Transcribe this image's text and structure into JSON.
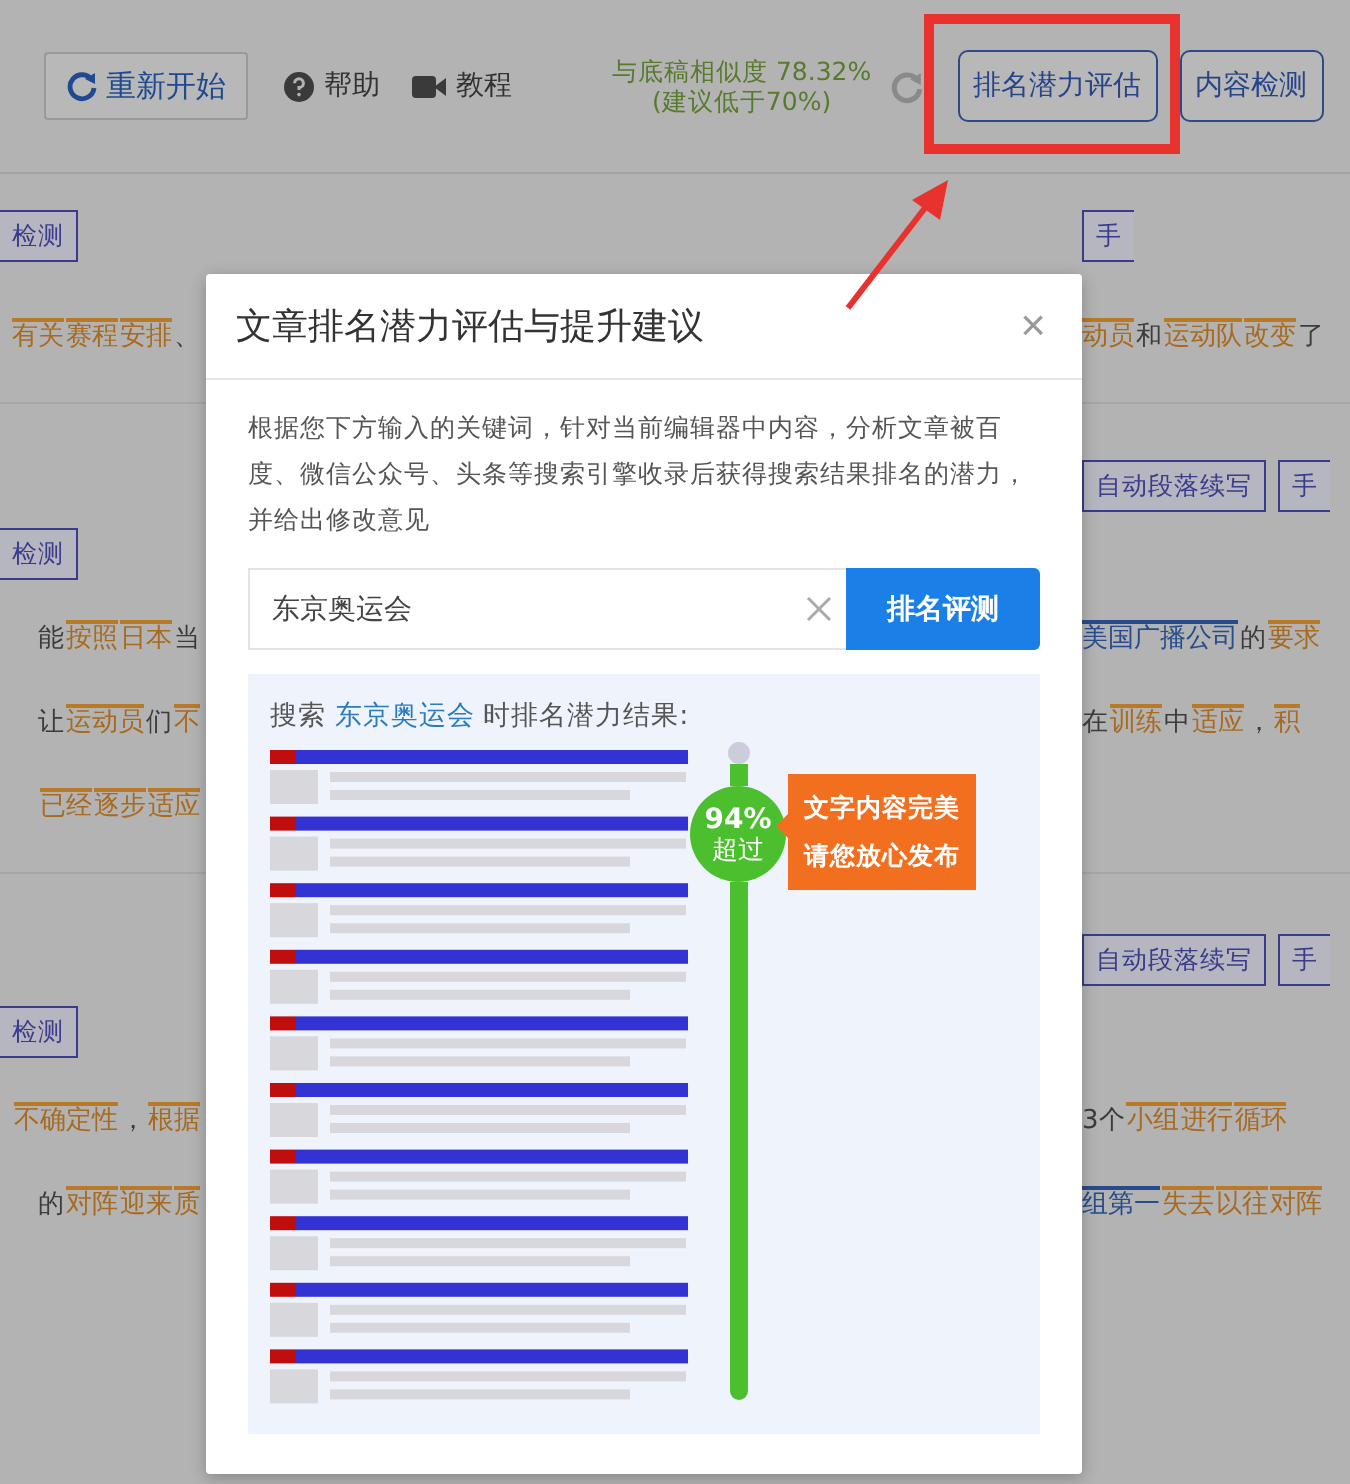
{
  "toolbar": {
    "restart_button": "重新开始",
    "help": "帮助",
    "tutorial": "教程",
    "similarity": "与底稿相似度 78.32%",
    "similarity_hint": "(建议低于70%)",
    "buttons": [
      {
        "label": "排名潜力评估",
        "highlighted": true
      },
      {
        "label": "内容检测",
        "highlighted": false
      }
    ]
  },
  "editor_rows": [
    {
      "kind": "buttons",
      "left": [
        "检测"
      ],
      "right": [
        "手"
      ]
    },
    {
      "kind": "text",
      "left": [
        {
          "text": "有关",
          "kind": "term"
        },
        {
          "text": "赛程",
          "kind": "term"
        },
        {
          "text": "安排",
          "kind": "term"
        },
        {
          "text": "、",
          "kind": "plain"
        }
      ],
      "right": [
        {
          "text": "动员",
          "kind": "term"
        },
        {
          "text": "和",
          "kind": "plain"
        },
        {
          "text": "运动队",
          "kind": "term"
        },
        {
          "text": "改变",
          "kind": "term"
        },
        {
          "text": "了",
          "kind": "plain"
        }
      ]
    },
    {
      "kind": "buttons",
      "left": [],
      "right": [
        "自动段落续写",
        "手"
      ]
    },
    {
      "kind": "buttons",
      "left": [
        "检测"
      ],
      "right": []
    },
    {
      "kind": "text",
      "left": [
        {
          "text": "能",
          "kind": "plain"
        },
        {
          "text": "按照",
          "kind": "term"
        },
        {
          "text": "日本",
          "kind": "term"
        },
        {
          "text": "当",
          "kind": "plain"
        }
      ],
      "right": [
        {
          "text": "美国广播公司",
          "kind": "entity"
        },
        {
          "text": "的",
          "kind": "plain"
        },
        {
          "text": "要求",
          "kind": "term"
        }
      ]
    },
    {
      "kind": "text",
      "left": [
        {
          "text": "让",
          "kind": "plain"
        },
        {
          "text": "运动员",
          "kind": "term"
        },
        {
          "text": "们",
          "kind": "plain"
        },
        {
          "text": "不",
          "kind": "term"
        }
      ],
      "right": [
        {
          "text": "在",
          "kind": "plain"
        },
        {
          "text": "训练",
          "kind": "term"
        },
        {
          "text": "中",
          "kind": "plain"
        },
        {
          "text": "适应",
          "kind": "term"
        },
        {
          "text": "，",
          "kind": "plain"
        },
        {
          "text": "积",
          "kind": "term"
        }
      ]
    },
    {
      "kind": "text",
      "left": [
        {
          "text": "已经",
          "kind": "term"
        },
        {
          "text": "逐步",
          "kind": "term"
        },
        {
          "text": "适应",
          "kind": "term"
        }
      ],
      "right": []
    },
    {
      "kind": "buttons",
      "left": [],
      "right": [
        "自动段落续写",
        "手"
      ]
    },
    {
      "kind": "buttons",
      "left": [
        "检测"
      ],
      "right": []
    },
    {
      "kind": "text",
      "left": [
        {
          "text": "不确定性",
          "kind": "term"
        },
        {
          "text": "，",
          "kind": "plain"
        },
        {
          "text": "根据",
          "kind": "term"
        }
      ],
      "right": [
        {
          "text": "3个",
          "kind": "plain"
        },
        {
          "text": "小组",
          "kind": "term"
        },
        {
          "text": "进行",
          "kind": "term"
        },
        {
          "text": "循环",
          "kind": "term"
        }
      ]
    },
    {
      "kind": "text",
      "left": [
        {
          "text": "的",
          "kind": "plain"
        },
        {
          "text": "对阵",
          "kind": "term"
        },
        {
          "text": "迎来",
          "kind": "term"
        },
        {
          "text": "质",
          "kind": "term"
        }
      ],
      "right": [
        {
          "text": "组第一",
          "kind": "entity"
        },
        {
          "text": "失去",
          "kind": "term"
        },
        {
          "text": "以往",
          "kind": "term"
        },
        {
          "text": "对阵",
          "kind": "term"
        }
      ]
    }
  ],
  "dialog": {
    "title": "文章排名潜力评估与提升建议",
    "close": "×",
    "description": "根据您下方输入的关键词，针对当前编辑器中内容，分析文章被百度、微信公众号、头条等搜索引擎收录后获得搜索结果排名的潜力，并给出修改意见",
    "keyword": "东京奥运会",
    "submit": "排名评测",
    "result_prefix": "搜索",
    "result_keyword": "东京奥运会",
    "result_suffix": "时排名潜力结果:",
    "meter": {
      "percent": "94%",
      "label": "超过"
    },
    "callout": [
      "文字内容完美",
      "请您放心发布"
    ]
  }
}
